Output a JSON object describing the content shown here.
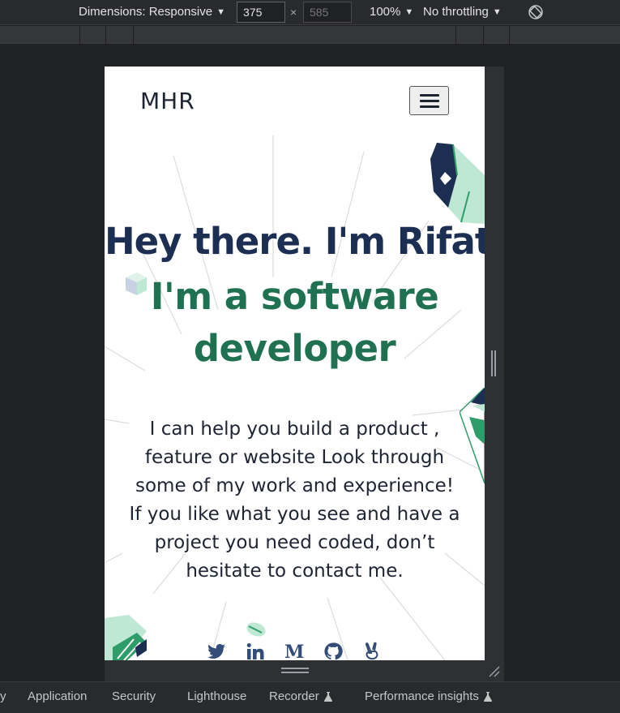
{
  "devtools": {
    "dimensions_label": "Dimensions: Responsive",
    "width_value": "375",
    "height_placeholder": "585",
    "times": "×",
    "zoom": "100%",
    "throttling": "No throttling",
    "tabs": [
      {
        "label": "y"
      },
      {
        "label": "Application"
      },
      {
        "label": "Security"
      },
      {
        "label": "Lighthouse"
      },
      {
        "label": "Recorder"
      },
      {
        "label": "Performance insights"
      }
    ]
  },
  "page": {
    "brand": "MHR",
    "hero_title": "Hey there. I'm Rifat.",
    "hero_subtitle": "I'm a software developer",
    "description": "I can help you build a product , feature or website Look through some of my work and experience! If you like what you see and have a project you need coded, don’t hesitate to contact me.",
    "socials": [
      {
        "icon": "twitter-icon"
      },
      {
        "icon": "linkedin-icon"
      },
      {
        "icon": "medium-icon"
      },
      {
        "icon": "github-icon"
      },
      {
        "icon": "angellist-icon"
      }
    ],
    "colors": {
      "title": "#1c2e52",
      "subtitle": "#1f7151",
      "text": "#1f2433",
      "icon": "#334d78",
      "accent_mint": "#bfe8d4",
      "accent_green": "#2f9d6a"
    }
  }
}
